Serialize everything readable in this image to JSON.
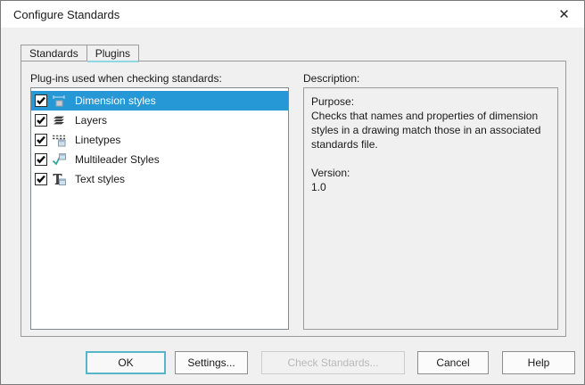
{
  "window": {
    "title": "Configure Standards",
    "close_icon": "✕"
  },
  "tabs": [
    {
      "label": "Standards",
      "active": false
    },
    {
      "label": "Plugins",
      "active": true
    }
  ],
  "plugins_panel": {
    "label": "Plug-ins used when checking standards:",
    "items": [
      {
        "label": "Dimension styles",
        "checked": true,
        "selected": true,
        "icon": "dimension-icon"
      },
      {
        "label": "Layers",
        "checked": true,
        "selected": false,
        "icon": "layers-icon"
      },
      {
        "label": "Linetypes",
        "checked": true,
        "selected": false,
        "icon": "linetypes-icon"
      },
      {
        "label": "Multileader Styles",
        "checked": true,
        "selected": false,
        "icon": "multileader-icon"
      },
      {
        "label": "Text styles",
        "checked": true,
        "selected": false,
        "icon": "text-styles-icon"
      }
    ]
  },
  "description_panel": {
    "label": "Description:",
    "purpose_label": "Purpose:",
    "purpose_text": "Checks that names and properties of dimension styles in a drawing match those in an associated standards file.",
    "version_label": "Version:",
    "version_value": "1.0"
  },
  "buttons": [
    {
      "label": "OK",
      "state": "default"
    },
    {
      "label": "Settings...",
      "state": "normal"
    },
    {
      "label": "Check Standards...",
      "state": "disabled"
    },
    {
      "label": "Cancel",
      "state": "normal"
    },
    {
      "label": "Help",
      "state": "normal"
    }
  ],
  "colors": {
    "selection_blue": "#2798d6",
    "focus_accent_teal": "#56b5c6",
    "tab_indicator_cyan": "#8fd8e2",
    "dialog_background": "#f0f0f0",
    "titlebar_background": "#ffffff"
  }
}
